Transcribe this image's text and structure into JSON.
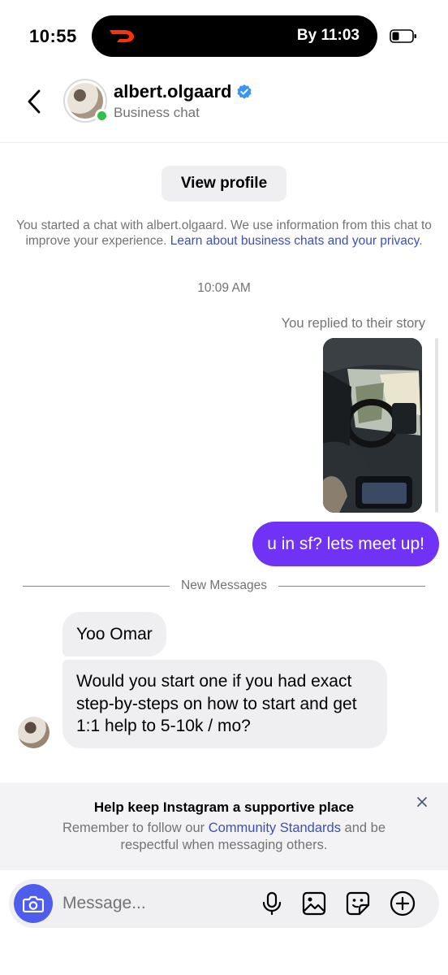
{
  "status_bar": {
    "time": "10:55",
    "live_activity_eta": "By 11:03",
    "live_activity_icon": "doordash-logo-icon",
    "battery_icon": "battery-icon"
  },
  "header": {
    "username": "albert.olgaard",
    "subtitle": "Business chat",
    "verified_icon": "verified-badge-icon",
    "online": true,
    "online_color": "#2fc24a"
  },
  "chat": {
    "view_profile_label": "View profile",
    "notice_text": "You started a chat with albert.olgaard. We use information from this chat to improve your experience. ",
    "notice_link": "Learn about business chats and your privacy",
    "notice_end": ".",
    "timestamp": "10:09 AM",
    "story_reply_label": "You replied to their story",
    "outgoing_message": "u in sf? lets meet up!",
    "divider_label": "New Messages",
    "incoming_messages": [
      "Yoo Omar",
      "Would you start one if you had exact step-by-steps on how to start and get 1:1 help to 5-10k / mo?"
    ]
  },
  "banner": {
    "title": "Help keep Instagram a supportive place",
    "text_before": "Remember to follow our ",
    "link": "Community Standards",
    "text_after": " and be respectful when messaging others."
  },
  "composer": {
    "placeholder": "Message...",
    "icons": [
      "camera-icon",
      "microphone-icon",
      "gallery-icon",
      "sticker-icon",
      "add-icon"
    ]
  },
  "colors": {
    "outgoing_bubble": "#7033f5",
    "incoming_bubble": "#efeff2",
    "link": "#3b4fbd",
    "camera_button": "#4f5dec"
  }
}
